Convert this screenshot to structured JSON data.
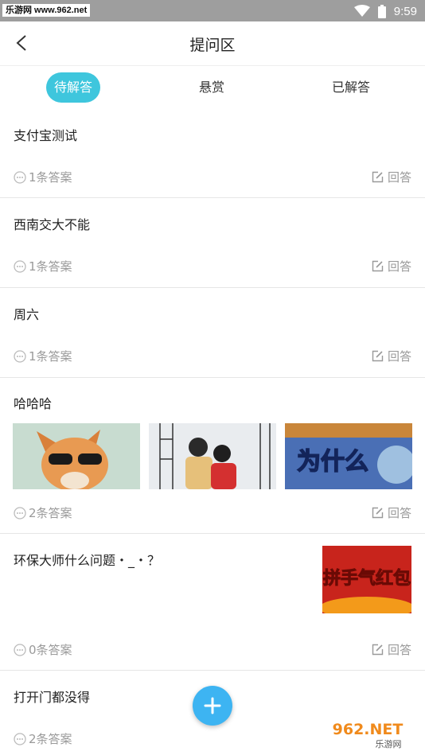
{
  "status_bar": {
    "watermark": "乐游网 www.962.net",
    "time": "9:59",
    "icons": [
      "wifi-icon",
      "battery-icon"
    ]
  },
  "header": {
    "title": "提问区",
    "back_icon": "back-arrow-icon"
  },
  "tabs": [
    {
      "label": "待解答",
      "active": true
    },
    {
      "label": "悬赏",
      "active": false
    },
    {
      "label": "已解答",
      "active": false
    }
  ],
  "questions": [
    {
      "title": "支付宝测试",
      "answers": "1条答案",
      "answer_label": "回答"
    },
    {
      "title": "西南交大不能",
      "answers": "1条答案",
      "answer_label": "回答"
    },
    {
      "title": "周六",
      "answers": "1条答案",
      "answer_label": "回答"
    },
    {
      "title": "哈哈哈",
      "answers": "2条答案",
      "answer_label": "回答",
      "images": [
        {
          "text": ""
        },
        {
          "text": ""
        },
        {
          "text": "为什么"
        }
      ]
    },
    {
      "title": "环保大师什么问题・_・？",
      "answers": "0条答案",
      "answer_label": "回答",
      "image": {
        "text": "拼手气红包"
      }
    },
    {
      "title": "打开门都没得",
      "answers": "2条答案",
      "answer_label": "回答"
    }
  ],
  "fab": {
    "icon": "plus-icon"
  },
  "branding": {
    "logo_text": "962.NET",
    "sub_text": "乐游网"
  },
  "colors": {
    "accent": "#3ec6dd",
    "fab": "#3db4f2",
    "status_bar": "#9e9e9e"
  }
}
